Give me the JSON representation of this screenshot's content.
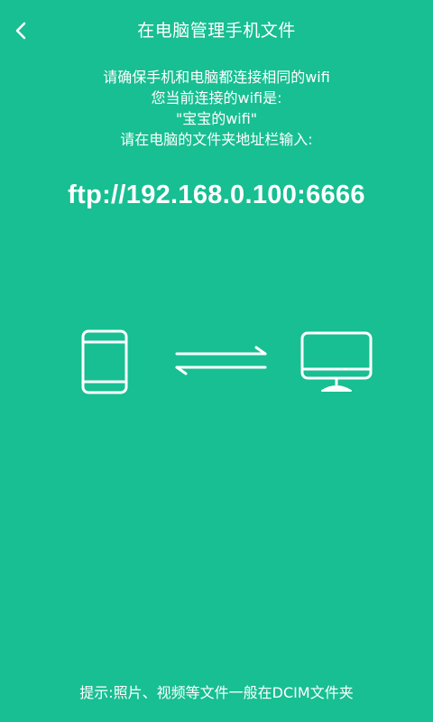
{
  "colors": {
    "background": "#17bf92",
    "foreground": "#ffffff"
  },
  "header": {
    "back_icon": "chevron-left-icon",
    "title": "在电脑管理手机文件"
  },
  "instructions": {
    "line1": "请确保手机和电脑都连接相同的wifi",
    "line2": "您当前连接的wifi是:",
    "line3": "\"宝宝的wifi\"",
    "line4": "请在电脑的文件夹地址栏输入:"
  },
  "ftp": {
    "address": "ftp://192.168.0.100:6666"
  },
  "illustration": {
    "left_icon": "phone-icon",
    "middle_icon": "transfer-arrows-icon",
    "right_icon": "monitor-icon"
  },
  "footer": {
    "tip": "提示:照片、视频等文件一般在DCIM文件夹"
  }
}
